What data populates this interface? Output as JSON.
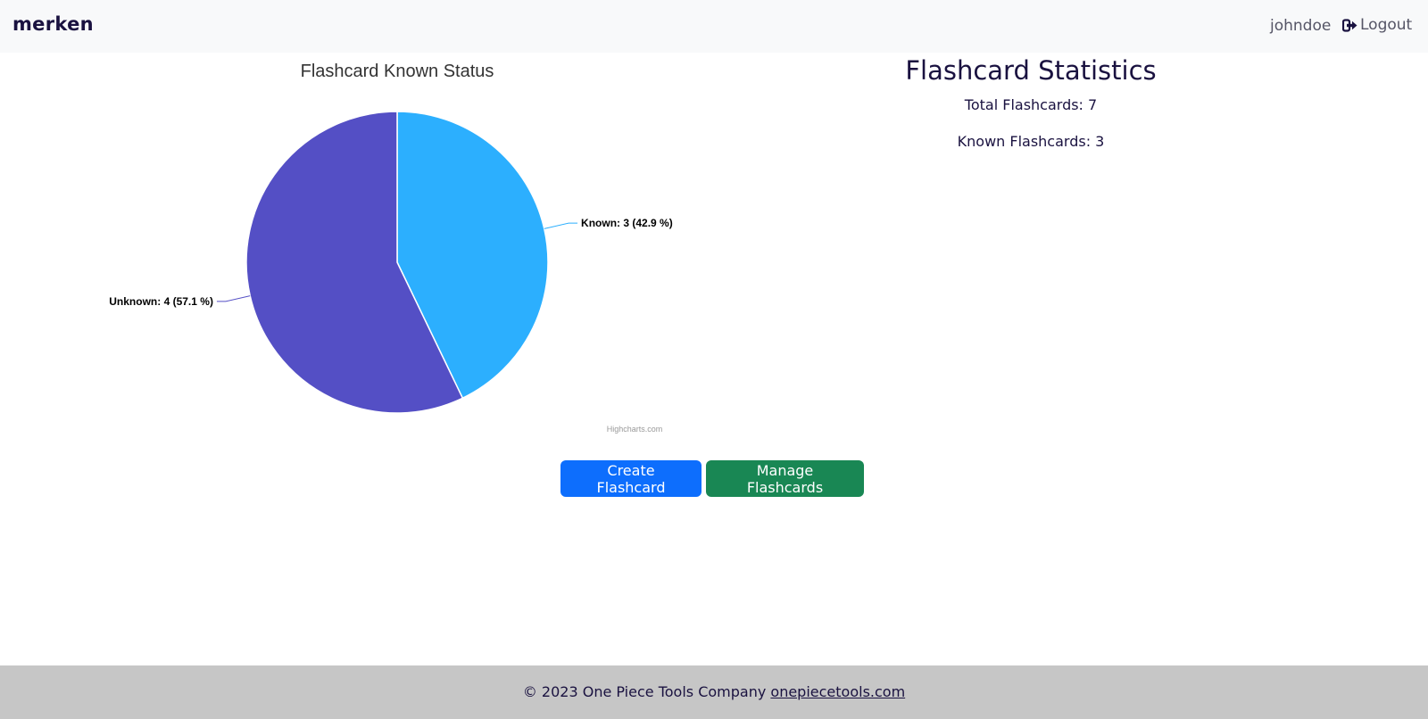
{
  "navbar": {
    "brand": "merken",
    "username": "johndoe",
    "logout_label": "Logout",
    "logout_icon": "logout-icon"
  },
  "chart_data": {
    "type": "pie",
    "title": "Flashcard Known Status",
    "categories": [
      "Known",
      "Unknown"
    ],
    "values": [
      3,
      4
    ],
    "percentages": [
      42.9,
      57.1
    ],
    "data_labels": [
      "Known: 3 (42.9 %)",
      "Unknown: 4 (57.1 %)"
    ],
    "colors": [
      "#2caffe",
      "#544fc5"
    ],
    "credits": "Highcharts.com"
  },
  "stats": {
    "heading": "Flashcard Statistics",
    "total_text": "Total Flashcards: 7",
    "known_text": "Known Flashcards: 3"
  },
  "actions": {
    "create_label": "Create Flashcard",
    "manage_label": "Manage Flashcards",
    "create_color": "#0d6efd",
    "manage_color": "#198754"
  },
  "footer": {
    "copyright": "© 2023 One Piece Tools Company",
    "link_text": "onepiecetools.com"
  }
}
